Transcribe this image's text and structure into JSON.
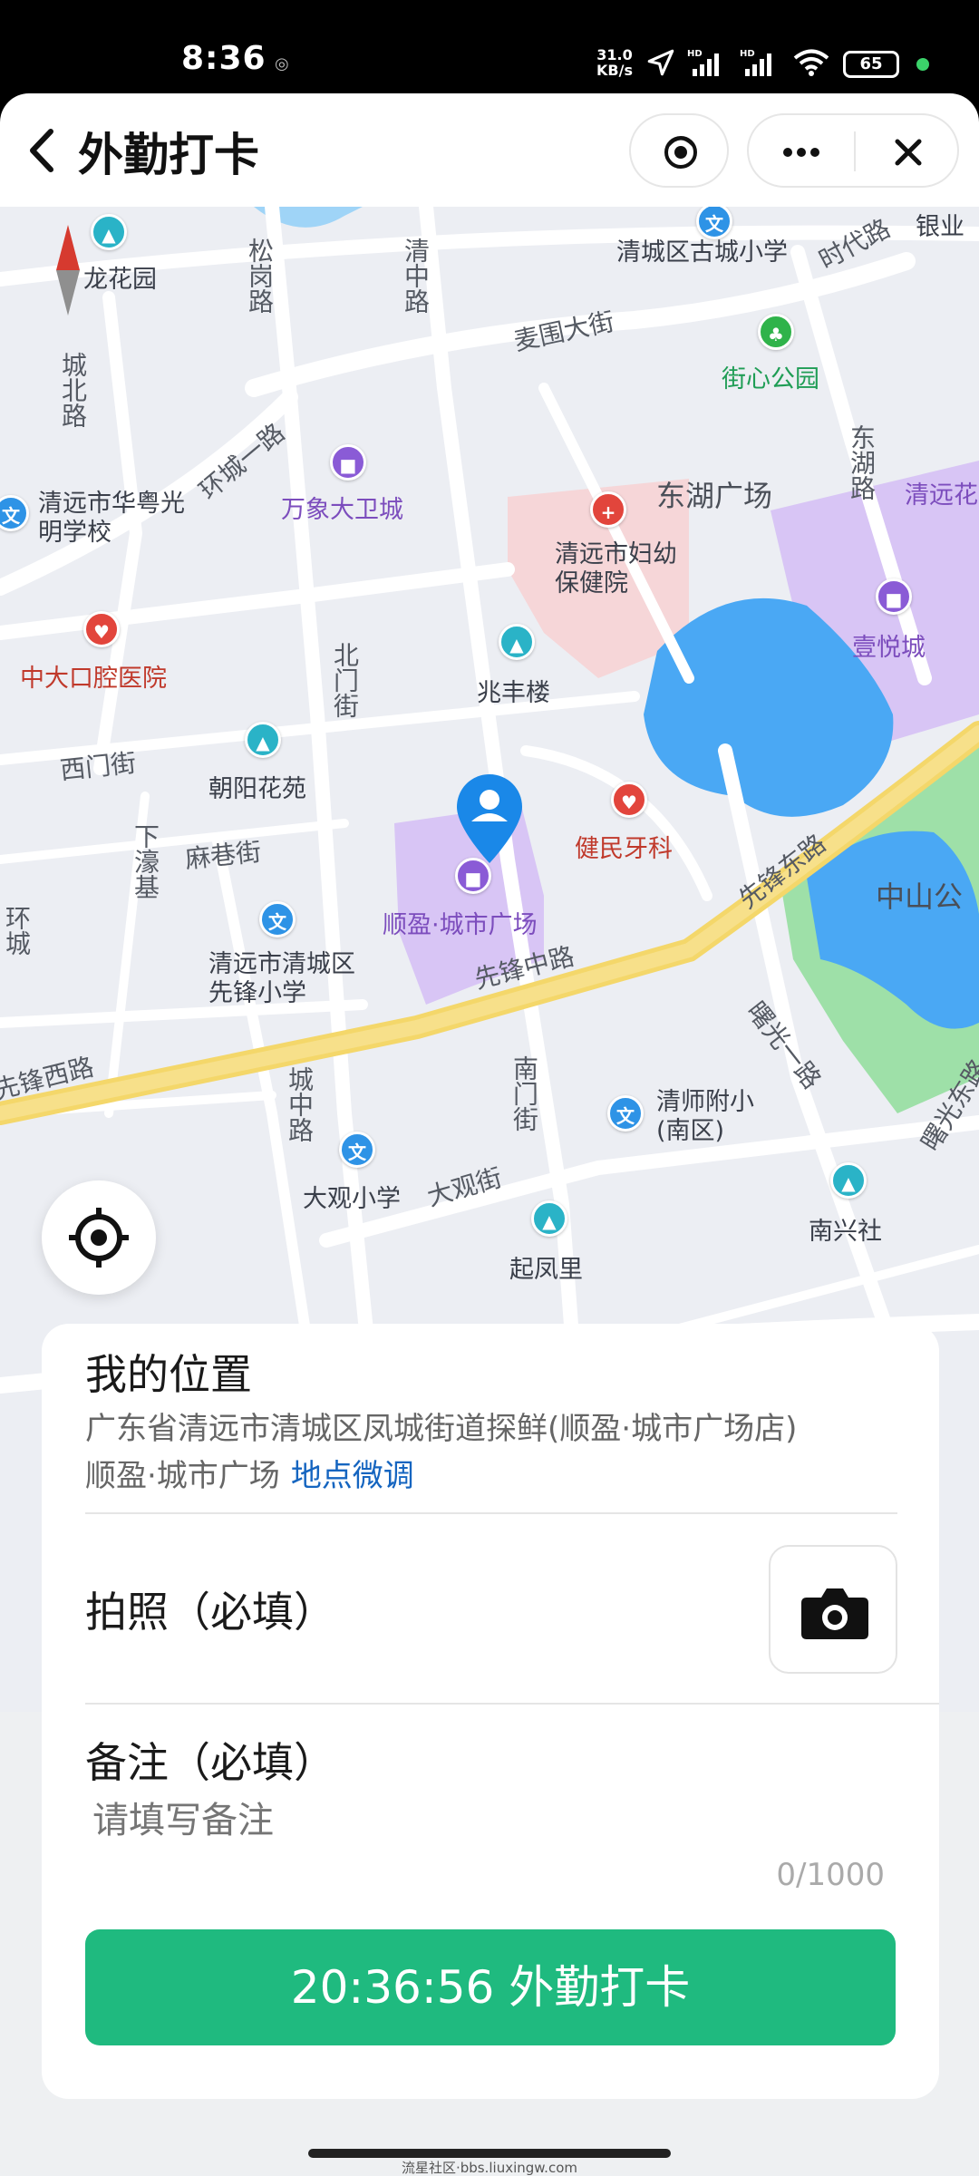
{
  "status_bar": {
    "time": "8:36",
    "network_speed_value": "31.0",
    "network_speed_unit": "KB/s",
    "battery": "65"
  },
  "header": {
    "title": "外勤打卡"
  },
  "map": {
    "labels": {
      "longhuayuan": "龙花园",
      "songgang": "松岗路",
      "qingzhong": "清中路",
      "gucheng_school": "清城区古城小学",
      "shidai": "时代路",
      "yinye": "银业",
      "maiwei": "麦围大街",
      "jiexin_park": "街心公园",
      "chengbei": "城北路",
      "huancheng": "环城一路",
      "wanxiang": "万象大卫城",
      "donghu": "东湖广场",
      "dongdi": "东湖路",
      "qingyuanhua": "清远花",
      "huayue_school": "清远市华粤光明学校",
      "fuyou": "清远市妇幼保健院",
      "zhongda": "中大口腔医院",
      "beimen": "北门街",
      "zhaofeng": "兆丰楼",
      "yiyue": "壹悦城",
      "ximen": "西门街",
      "chaoyang": "朝阳花苑",
      "jianmin": "健民牙科",
      "xiahao": "下濠基",
      "maxiang": "麻巷街",
      "shunying": "顺盈·城市广场",
      "xianfeng_east": "先锋东路",
      "zhongshan": "中山公",
      "huancheng2": "环城",
      "xianfeng_school": "清远市清城区先锋小学",
      "xianfeng_mid": "先锋中路",
      "shuguang": "曙光一路",
      "xianfeng_west": "先锋西路",
      "chengzhong": "城中路",
      "nanmen": "南门街",
      "qingshi": "清师附小(南区)",
      "shuguang_east": "曙光东路",
      "daguan_school": "大观小学",
      "daguan": "大观街",
      "qifeng": "起凤里",
      "nanxing": "南兴社"
    }
  },
  "location": {
    "title": "我的位置",
    "address": "广东省清远市清城区凤城街道探鲜(顺盈·城市广场店)",
    "place": "顺盈·城市广场",
    "adjust_link": "地点微调"
  },
  "photo": {
    "label": "拍照（必填）"
  },
  "note": {
    "label": "备注（必填）",
    "placeholder": "请填写备注",
    "counter": "0/1000"
  },
  "submit": {
    "label": "20:36:56 外勤打卡"
  },
  "watermark": "流星社区·bbs.liuxingw.com"
}
